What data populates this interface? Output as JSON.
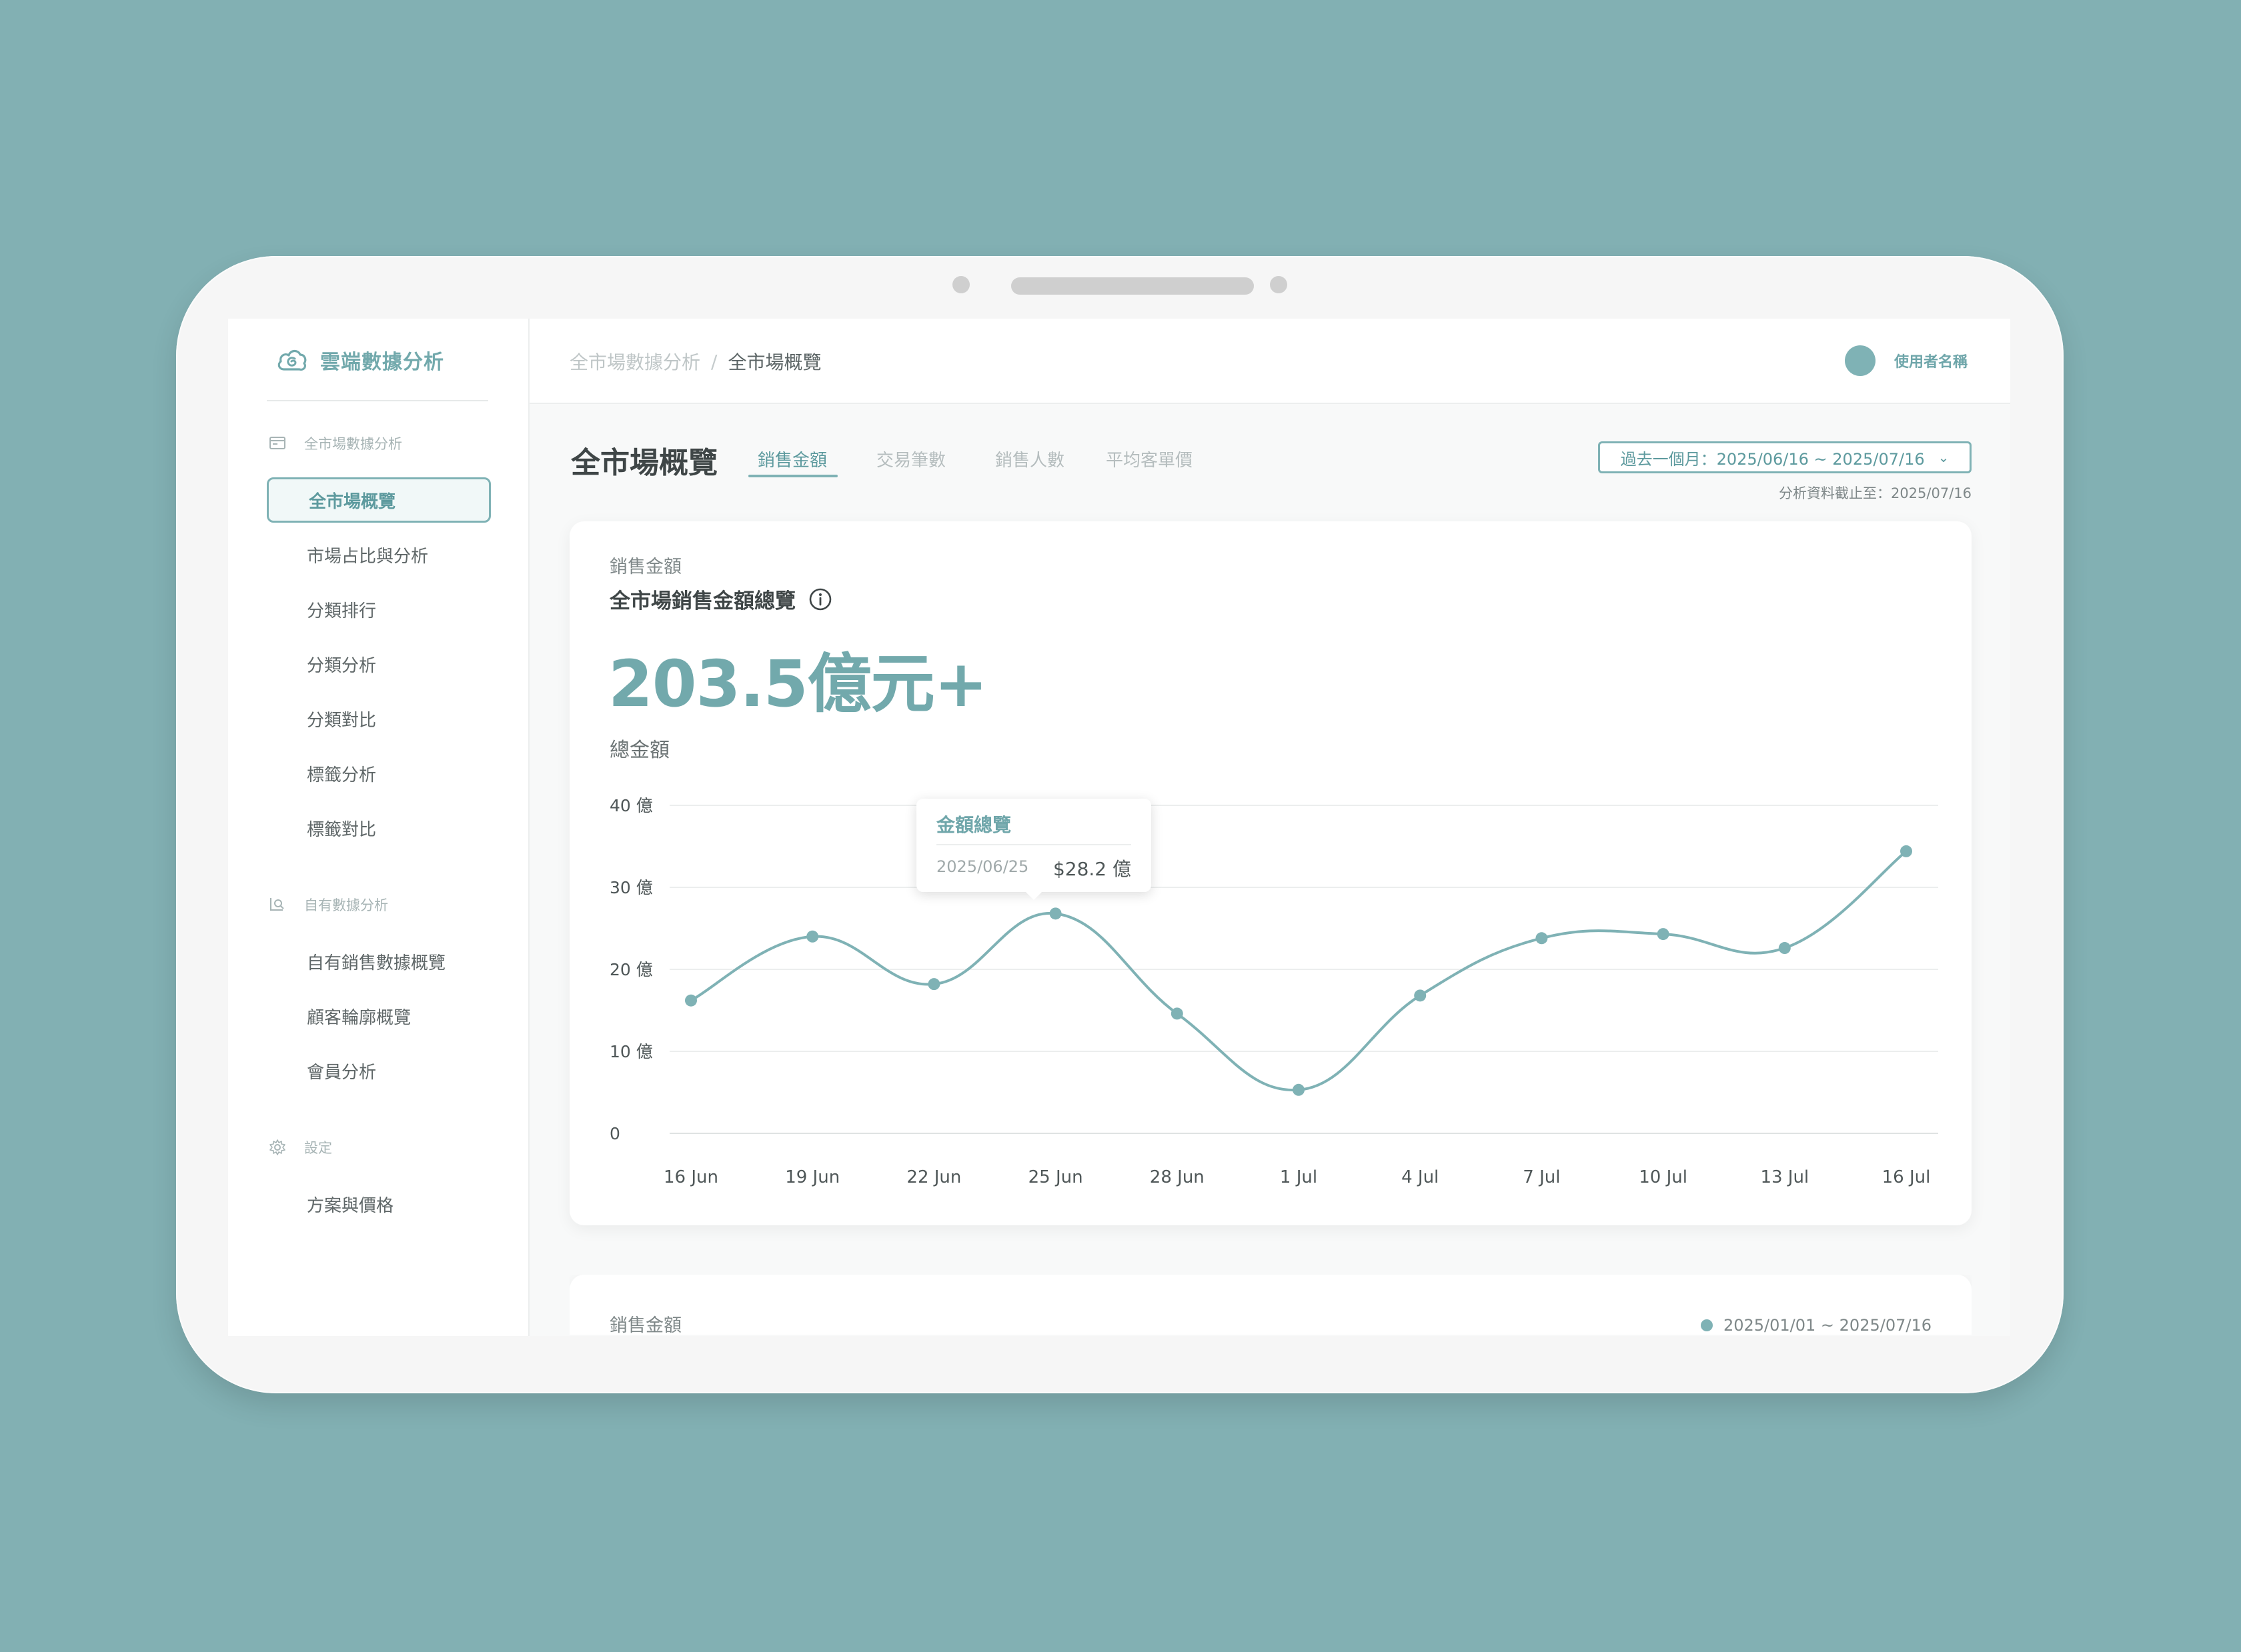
{
  "brand": {
    "name": "雲端數據分析"
  },
  "sidebar": {
    "sections": [
      {
        "label": "全市場數據分析",
        "icon": "window-icon",
        "items": [
          "全市場概覽",
          "市場占比與分析",
          "分類排行",
          "分類分析",
          "分類對比",
          "標籤分析",
          "標籤對比"
        ]
      },
      {
        "label": "自有數據分析",
        "icon": "chart-magnifier-icon",
        "items": [
          "自有銷售數據概覽",
          "顧客輪廓概覽",
          "會員分析"
        ]
      },
      {
        "label": "設定",
        "icon": "gear-icon",
        "items": [
          "方案與價格"
        ]
      }
    ],
    "active_item": "全市場概覽"
  },
  "breadcrumb": {
    "parent": "全市場數據分析",
    "separator": "/",
    "current": "全市場概覽"
  },
  "user": {
    "name": "使用者名稱"
  },
  "page": {
    "title": "全市場概覽",
    "tabs": [
      "銷售金額",
      "交易筆數",
      "銷售人數",
      "平均客單價"
    ],
    "active_tab": "銷售金額",
    "date_range": "過去一個月：2025/06/16 ~ 2025/07/16",
    "as_of": "分析資料截止至：2025/07/16"
  },
  "card": {
    "eyebrow": "銷售金額",
    "title": "全市場銷售金額總覽",
    "big_number": "203.5億元+",
    "chart_label": "總金額"
  },
  "tooltip": {
    "title": "金額總覽",
    "date": "2025/06/25",
    "value": "$28.2 億"
  },
  "card2": {
    "eyebrow": "銷售金額",
    "legend": "2025/01/01 ~ 2025/07/16"
  },
  "colors": {
    "accent": "#7fb2b5",
    "accent_dark": "#5d9a9e",
    "background": "#82b0b3"
  },
  "chart_data": {
    "type": "line",
    "x": [
      "16 Jun",
      "19 Jun",
      "22 Jun",
      "25 Jun",
      "28 Jun",
      "1 Jul",
      "4 Jul",
      "7 Jul",
      "10 Jul",
      "13 Jul",
      "16 Jul"
    ],
    "series": [
      {
        "values": [
          16.2,
          24.0,
          18.2,
          26.8,
          14.6,
          5.3,
          16.8,
          23.8,
          24.3,
          22.6,
          34.4
        ]
      }
    ],
    "y_ticks": [
      "40 億",
      "30 億",
      "20 億",
      "10 億",
      "0"
    ],
    "ylim": [
      0,
      40
    ],
    "grid": true
  }
}
